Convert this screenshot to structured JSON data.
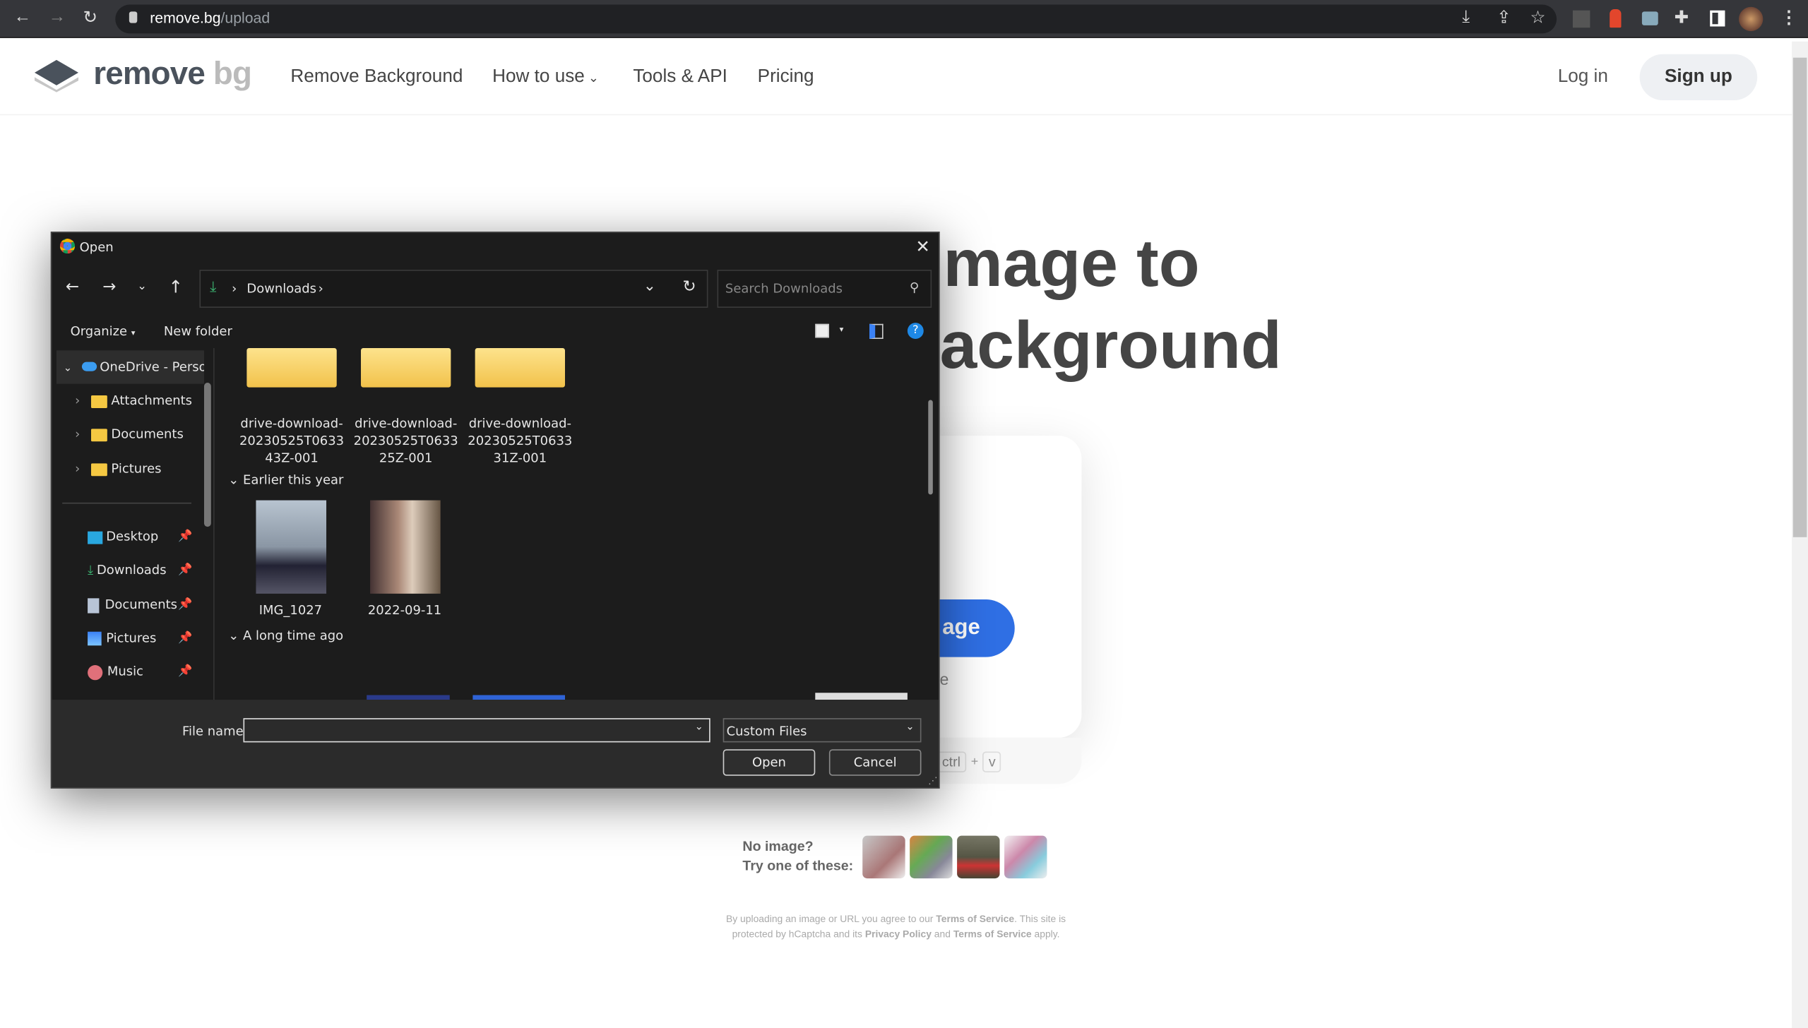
{
  "browser": {
    "url_host": "remove.bg",
    "url_path": "/upload",
    "icons": [
      "back-icon",
      "forward-icon",
      "reload-icon",
      "lock-icon",
      "install-icon",
      "share-icon",
      "star-icon",
      "extension-icon",
      "puzzle-icon",
      "sidepanel-icon",
      "profile-avatar",
      "menu-icon"
    ]
  },
  "site": {
    "logo_main": "remove",
    "logo_bg": "bg",
    "nav": [
      "Remove Background",
      "How to use",
      "Tools & API",
      "Pricing"
    ],
    "login": "Log in",
    "signup": "Sign up",
    "hero_line1": "mage to",
    "hero_line2": "ackground",
    "upload_button": "age",
    "upload_sub": "e",
    "paste_keys": [
      "ctrl",
      "+",
      "v"
    ],
    "no_image": "No image?",
    "try_one": "Try one of these:",
    "legal": {
      "p1": "By uploading an image or URL you agree to our ",
      "tos": "Terms of Service",
      "p2": ". This site is protected by hCaptcha and its ",
      "privacy": "Privacy Policy",
      "p3": " and ",
      "tos2": "Terms of Service",
      "p4": " apply."
    }
  },
  "dialog": {
    "title": "Open",
    "breadcrumb": "Downloads",
    "search_placeholder": "Search Downloads",
    "organize": "Organize",
    "new_folder": "New folder",
    "sidebar": [
      {
        "label": "OneDrive - Perso",
        "icon": "cloud-icon"
      },
      {
        "label": "Attachments",
        "icon": "folder-icon"
      },
      {
        "label": "Documents",
        "icon": "folder-icon"
      },
      {
        "label": "Pictures",
        "icon": "folder-icon"
      },
      {
        "label": "Desktop",
        "icon": "desktop-icon",
        "pinned": true
      },
      {
        "label": "Downloads",
        "icon": "download-icon",
        "pinned": true
      },
      {
        "label": "Documents",
        "icon": "document-icon",
        "pinned": true
      },
      {
        "label": "Pictures",
        "icon": "pictures-icon",
        "pinned": true
      },
      {
        "label": "Music",
        "icon": "music-icon",
        "pinned": true
      }
    ],
    "folders": [
      {
        "l1": "drive-download-",
        "l2": "20230525T0633",
        "l3": "43Z-001"
      },
      {
        "l1": "drive-download-",
        "l2": "20230525T0633",
        "l3": "25Z-001"
      },
      {
        "l1": "drive-download-",
        "l2": "20230525T0633",
        "l3": "31Z-001"
      }
    ],
    "group_earlier": "Earlier this year",
    "images": [
      "IMG_1027",
      "2022-09-11"
    ],
    "group_long": "A long time ago",
    "file_name_label": "File name:",
    "file_name_value": "",
    "file_type": "Custom Files",
    "open": "Open",
    "cancel": "Cancel"
  }
}
